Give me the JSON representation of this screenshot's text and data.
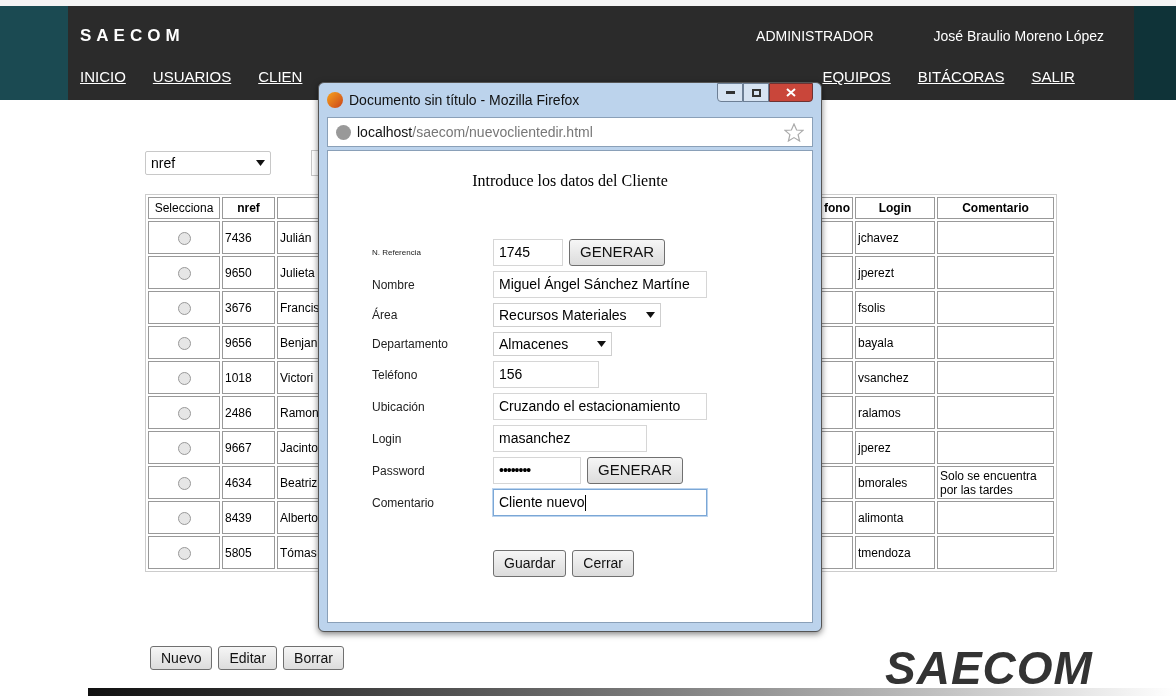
{
  "header": {
    "brand": "SAECOM",
    "role": "ADMINISTRADOR",
    "user": "José Braulio Moreno López",
    "nav": [
      {
        "label": "INICIO"
      },
      {
        "label": "USUARIOS"
      },
      {
        "label": "CLIEN"
      },
      {
        "label": "EQUIPOS"
      },
      {
        "label": "BITÁCORAS"
      },
      {
        "label": "SALIR"
      }
    ]
  },
  "filter": {
    "field": "nref"
  },
  "table": {
    "columns": [
      "Selecciona",
      "nref",
      "",
      "fono",
      "Login",
      "Comentario"
    ],
    "rows": [
      {
        "selected": false,
        "nref": "7436",
        "name": "Julián",
        "login": "jchavez",
        "comment": ""
      },
      {
        "selected": false,
        "nref": "9650",
        "name": "Julieta",
        "login": "jperezt",
        "comment": ""
      },
      {
        "selected": false,
        "nref": "3676",
        "name": "Francis",
        "login": "fsolis",
        "comment": ""
      },
      {
        "selected": false,
        "nref": "9656",
        "name": "Benjan",
        "login": "bayala",
        "comment": ""
      },
      {
        "selected": false,
        "nref": "1018",
        "name": "Victori",
        "login": "vsanchez",
        "comment": ""
      },
      {
        "selected": false,
        "nref": "2486",
        "name": "Ramon",
        "login": "ralamos",
        "comment": ""
      },
      {
        "selected": false,
        "nref": "9667",
        "name": "Jacinto",
        "login": "jperez",
        "comment": ""
      },
      {
        "selected": false,
        "nref": "4634",
        "name": "Beatriz",
        "login": "bmorales",
        "comment": "Solo se encuentra por las tardes"
      },
      {
        "selected": false,
        "nref": "8439",
        "name": "Alberto",
        "login": "alimonta",
        "comment": ""
      },
      {
        "selected": false,
        "nref": "5805",
        "name": "Tómas",
        "login": "tmendoza",
        "comment": ""
      }
    ]
  },
  "actions": [
    "Nuevo",
    "Editar",
    "Borrar"
  ],
  "logo": "SAECOM",
  "popup": {
    "title": "Documento sin título - Mozilla Firefox",
    "url_host": "localhost",
    "url_path": "/saecom/nuevoclientedir.html",
    "heading": "Introduce los datos del Cliente",
    "fields": [
      {
        "label": "N. Referencia",
        "kind": "text",
        "value": "1745",
        "button": "GENERAR",
        "focused": false
      },
      {
        "label": "Nombre",
        "kind": "text",
        "value": "Miguel Ángel Sánchez Martíne",
        "focused": false
      },
      {
        "label": "Área",
        "kind": "select",
        "value": "Recursos Materiales",
        "focused": false
      },
      {
        "label": "Departamento",
        "kind": "select",
        "value": "Almacenes",
        "focused": false
      },
      {
        "label": "Teléfono",
        "kind": "text",
        "value": "156",
        "focused": false
      },
      {
        "label": "Ubicación",
        "kind": "text",
        "value": "Cruzando el estacionamiento",
        "focused": false
      },
      {
        "label": "Login",
        "kind": "text",
        "value": "masanchez",
        "focused": false
      },
      {
        "label": "Password",
        "kind": "password",
        "value": "••••••••",
        "button": "GENERAR",
        "focused": false
      },
      {
        "label": "Comentario",
        "kind": "text",
        "value": "Cliente nuevo",
        "focused": true
      }
    ],
    "buttons": [
      "Guardar",
      "Cerrar"
    ]
  }
}
